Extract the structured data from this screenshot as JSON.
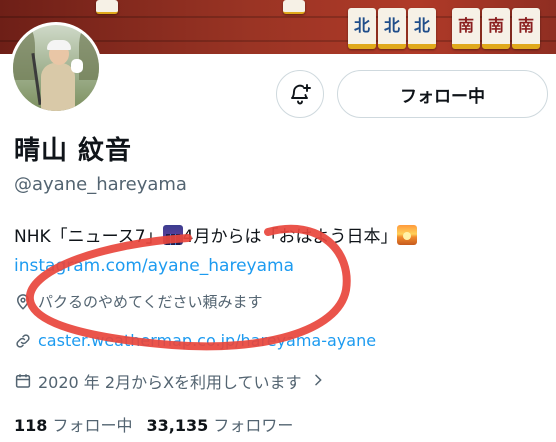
{
  "banner": {
    "tiles": [
      "北",
      "北",
      "北",
      "南",
      "南",
      "南"
    ]
  },
  "actions": {
    "follow_label": "フォロー中"
  },
  "profile": {
    "name": "晴山 紋音",
    "handle": "@ayane_hareyama",
    "bio_part1": "NHK「ニュース7」",
    "bio_part2": "4月からは「おはよう日本」",
    "link": "instagram.com/ayane_hareyama",
    "location": "パクるのやめてください頼みます",
    "website": "caster.weathermap.co.jp/hareyama-ayane",
    "joined": "2020 年 2月からXを利用しています",
    "following_count": "118",
    "following_label": "フォロー中",
    "followers_count": "33,135",
    "followers_label": "フォロワー"
  },
  "icons": {
    "bell": "bell-plus-icon",
    "location": "location-pin-icon",
    "link": "link-icon",
    "calendar": "calendar-icon",
    "chevron": "chevron-right-icon"
  },
  "colors": {
    "accent_link": "#1d9bf0",
    "secondary_text": "#536471",
    "annotation_stroke": "#e8453c",
    "banner": "#9a3424"
  }
}
